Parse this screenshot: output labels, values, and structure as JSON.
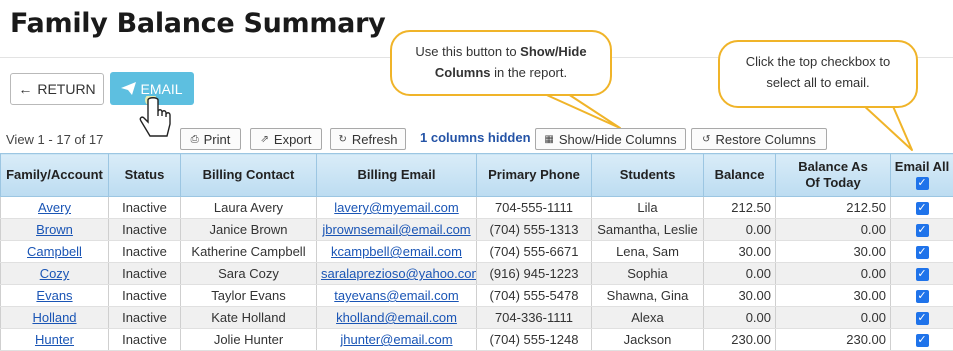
{
  "page": {
    "title": "Family Balance Summary"
  },
  "actions": {
    "return_label": "RETURN",
    "email_label": "EMAIL"
  },
  "callouts": {
    "show_hide": {
      "pre": "Use this button to ",
      "bold_1": "Show/Hide",
      "bold_2": "Columns",
      "post": " in the report."
    },
    "email_all": {
      "line1": "Click the top checkbox to",
      "line2": "select all to email."
    }
  },
  "toolbar": {
    "view_count": "View 1 - 17 of 17",
    "print_label": "Print",
    "export_label": "Export",
    "refresh_label": "Refresh",
    "hidden_columns": "1 columns hidden",
    "show_hide_label": "Show/Hide Columns",
    "restore_label": "Restore Columns"
  },
  "table": {
    "headers": {
      "family": "Family/Account",
      "status": "Status",
      "contact": "Billing Contact",
      "email": "Billing Email",
      "phone": "Primary Phone",
      "students": "Students",
      "balance": "Balance",
      "balance_today_1": "Balance As",
      "balance_today_2": "Of Today",
      "email_all": "Email All"
    },
    "email_all_checked": true,
    "rows": [
      {
        "family": "Avery",
        "status": "Inactive",
        "contact": "Laura Avery",
        "email": "lavery@myemail.com",
        "phone": "704-555-1111",
        "students": "Lila",
        "balance": "212.50",
        "balance_today": "212.50",
        "checked": true
      },
      {
        "family": "Brown",
        "status": "Inactive",
        "contact": "Janice Brown",
        "email": "jbrownsemail@email.com",
        "phone": "(704) 555-1313",
        "students": "Samantha, Leslie",
        "balance": "0.00",
        "balance_today": "0.00",
        "checked": true
      },
      {
        "family": "Campbell",
        "status": "Inactive",
        "contact": "Katherine Campbell",
        "email": "kcampbell@email.com",
        "phone": "(704) 555-6671",
        "students": "Lena, Sam",
        "balance": "30.00",
        "balance_today": "30.00",
        "checked": true
      },
      {
        "family": "Cozy",
        "status": "Inactive",
        "contact": "Sara Cozy",
        "email": "saralaprezioso@yahoo.com",
        "phone": "(916) 945-1223",
        "students": "Sophia",
        "balance": "0.00",
        "balance_today": "0.00",
        "checked": true
      },
      {
        "family": "Evans",
        "status": "Inactive",
        "contact": "Taylor Evans",
        "email": "tayevans@email.com",
        "phone": "(704) 555-5478",
        "students": "Shawna, Gina",
        "balance": "30.00",
        "balance_today": "30.00",
        "checked": true
      },
      {
        "family": "Holland",
        "status": "Inactive",
        "contact": "Kate Holland",
        "email": "kholland@email.com",
        "phone": "704-336-1111",
        "students": "Alexa",
        "balance": "0.00",
        "balance_today": "0.00",
        "checked": true
      },
      {
        "family": "Hunter",
        "status": "Inactive",
        "contact": "Jolie Hunter",
        "email": "jhunter@email.com",
        "phone": "(704) 555-1248",
        "students": "Jackson",
        "balance": "230.00",
        "balance_today": "230.00",
        "checked": true
      }
    ]
  },
  "colors": {
    "email_button": "#5dbfe0",
    "callout_border": "#f0b429",
    "link": "#1a55b5",
    "header_bg": "#bcdcf1",
    "checkbox": "#1f73ea"
  },
  "icons": [
    "arrow-left-icon",
    "paper-plane-icon",
    "hand-pointer-icon",
    "print-icon",
    "export-icon",
    "refresh-icon",
    "columns-icon",
    "restore-icon"
  ]
}
